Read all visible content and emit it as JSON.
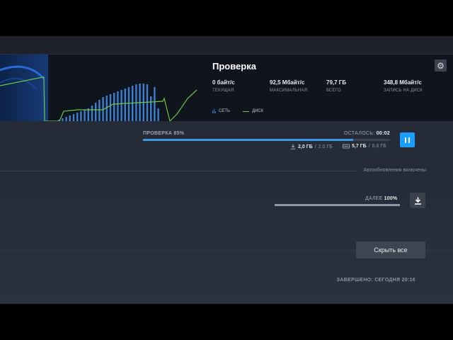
{
  "stats": {
    "title": "Проверка",
    "items": [
      {
        "value": "0 байт/с",
        "label": "ТЕКУЩАЯ"
      },
      {
        "value": "92,5 Мбайт/с",
        "label": "МАКСИМАЛЬНАЯ"
      },
      {
        "value": "79,7 ГБ",
        "label": "ВСЕГО"
      },
      {
        "value": "348,8 Мбайт/с",
        "label": "ЗАПИСЬ НА ДИСК"
      }
    ],
    "legend": {
      "network": "СЕТЬ",
      "disk": "ДИСК"
    },
    "colors": {
      "network": "#3d7fce",
      "disk": "#6ac54a"
    }
  },
  "progress": {
    "label": "ПРОВЕРКА 85%",
    "percent": 85,
    "remaining_label": "ОСТАЛОСЬ:",
    "remaining_value": "00:02",
    "download_done": "2,0 ГБ",
    "download_total": "2,0 ГБ",
    "disk_done": "5,7 ГБ",
    "disk_total": "6,6 ГБ",
    "accent": "#1a9fff"
  },
  "queue": {
    "autoupdate_text": "Автообновления включены",
    "next_label": "ДАЛЕЕ",
    "next_percent_text": "100%",
    "next_percent": 100
  },
  "actions": {
    "hide_all": "Скрыть все"
  },
  "completed": {
    "text": "ЗАВЕРШЕНО: СЕГОДНЯ 20:16"
  }
}
